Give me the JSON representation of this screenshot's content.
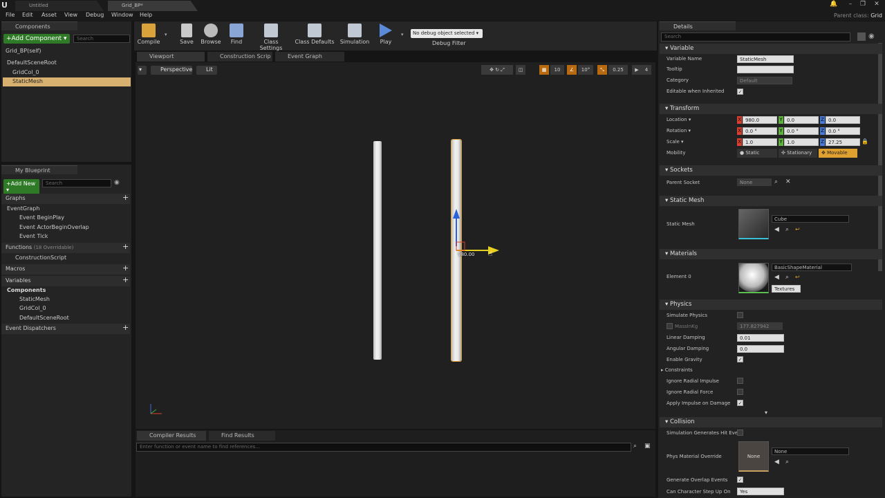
{
  "titlebar": {
    "tabs": [
      "Untitled",
      "Grid_BP*"
    ],
    "parent_class_label": "Parent class:",
    "parent_class_value": "Grid",
    "controls": [
      "🔔",
      "–",
      "❐",
      "✕"
    ]
  },
  "menu": [
    "File",
    "Edit",
    "Asset",
    "View",
    "Debug",
    "Window",
    "Help"
  ],
  "components": {
    "tab": "Components",
    "add_label": "+Add Component ▾",
    "search_placeholder": "Search",
    "self_label": "Grid_BP(self)",
    "tree": [
      "DefaultSceneRoot",
      "GridCol_0",
      "StaticMesh"
    ]
  },
  "my_blueprint": {
    "tab": "My Blueprint",
    "add_new": "+Add New ▾",
    "search_placeholder": "Search",
    "graphs_label": "Graphs",
    "graph_name": "EventGraph",
    "events": [
      "Event BeginPlay",
      "Event ActorBeginOverlap",
      "Event Tick"
    ],
    "functions_label": "Functions",
    "functions_count": "(18 Overridable)",
    "construction_script": "ConstructionScript",
    "macros_label": "Macros",
    "variables_label": "Variables",
    "components_label": "Components",
    "variable_components": [
      "StaticMesh",
      "GridCol_0",
      "DefaultSceneRoot"
    ],
    "event_dispatchers": "Event Dispatchers"
  },
  "toolbar": {
    "compile": "Compile",
    "save": "Save",
    "browse": "Browse",
    "find": "Find",
    "class_settings": "Class Settings",
    "class_defaults": "Class Defaults",
    "simulation": "Simulation",
    "play": "Play",
    "debug_select": "No debug object selected ▾",
    "debug_filter": "Debug Filter"
  },
  "editor_tabs": [
    "Viewport",
    "Construction Scrip",
    "Event Graph"
  ],
  "viewport": {
    "perspective": "Perspective",
    "lit": "Lit",
    "snap_values": [
      "10",
      "10°",
      "0.25",
      "4"
    ],
    "gizmo_readout": "980.00"
  },
  "bottom": {
    "tabs": [
      "Compiler Results",
      "Find Results"
    ],
    "find_placeholder": "Enter function or event name to find references..."
  },
  "details": {
    "tab": "Details",
    "search_placeholder": "Search",
    "variable": {
      "header": "Variable",
      "variable_name_label": "Variable Name",
      "variable_name": "StaticMesh",
      "tooltip_label": "Tooltip",
      "tooltip": "",
      "category_label": "Category",
      "category": "Default",
      "editable_label": "Editable when Inherited",
      "editable": true
    },
    "transform": {
      "header": "Transform",
      "location_label": "Location ▾",
      "location": [
        "980.0",
        "0.0",
        "0.0"
      ],
      "rotation_label": "Rotation ▾",
      "rotation": [
        "0.0 °",
        "0.0 °",
        "0.0 °"
      ],
      "scale_label": "Scale ▾",
      "scale": [
        "1.0",
        "1.0",
        "27.25"
      ],
      "mobility_label": "Mobility",
      "mobility_options": [
        "Static",
        "Stationary",
        "Movable"
      ],
      "mobility_selected": "Movable"
    },
    "sockets": {
      "header": "Sockets",
      "parent_socket_label": "Parent Socket",
      "parent_socket": "None"
    },
    "static_mesh": {
      "header": "Static Mesh",
      "label": "Static Mesh",
      "value": "Cube"
    },
    "materials": {
      "header": "Materials",
      "element_label": "Element 0",
      "value": "BasicShapeMaterial",
      "textures": "Textures ▾"
    },
    "physics": {
      "header": "Physics",
      "simulate_label": "Simulate Physics",
      "simulate": false,
      "mass_label": "MassInKg",
      "mass": "177.827942",
      "linear_damping_label": "Linear Damping",
      "linear_damping": "0.01",
      "angular_damping_label": "Angular Damping",
      "angular_damping": "0.0",
      "gravity_label": "Enable Gravity",
      "gravity": true,
      "constraints_label": "Constraints",
      "radial_impulse_label": "Ignore Radial Impulse",
      "radial_impulse": false,
      "radial_force_label": "Ignore Radial Force",
      "radial_force": false,
      "impulse_damage_label": "Apply Impulse on Damage",
      "impulse_damage": true
    },
    "collision": {
      "header": "Collision",
      "sim_hit_label": "Simulation Generates Hit Eve",
      "sim_hit": false,
      "phys_material_label": "Phys Material Override",
      "phys_material": "None",
      "phys_thumb": "None",
      "overlap_label": "Generate Overlap Events",
      "overlap": true,
      "step_up_label": "Can Character Step Up On",
      "step_up": "Yes"
    }
  },
  "colors": {
    "accent_orange": "#e0a030",
    "selection": "#d8b070",
    "add_green": "#2f7a27"
  }
}
